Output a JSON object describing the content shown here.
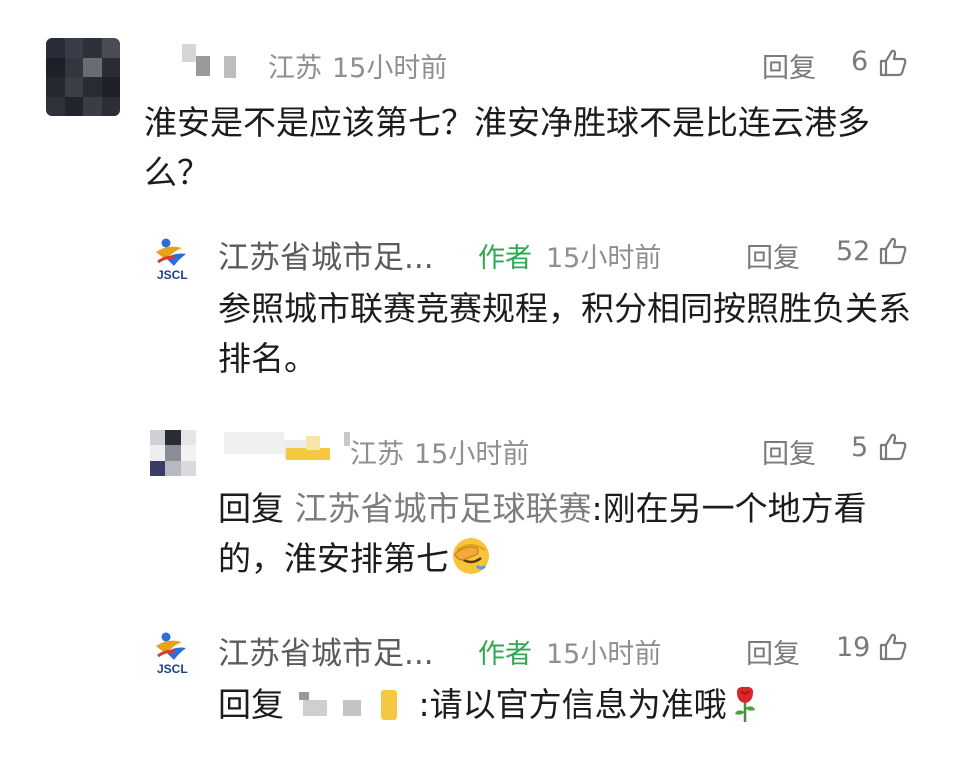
{
  "comments": [
    {
      "region": "江苏",
      "time": "15小时前",
      "text": "淮安是不是应该第七？淮安净胜球不是比连云港多么？",
      "reply_label": "回复",
      "likes": "6"
    },
    {
      "user_name": "江苏省城市足...",
      "author_badge": "作者",
      "time": "15小时前",
      "text": "参照城市联赛竞赛规程，积分相同按照胜负关系排名。",
      "reply_label": "回复",
      "likes": "52",
      "avatar_text": "JSCL"
    },
    {
      "region": "江苏",
      "time": "15小时前",
      "reply_prefix": "回复",
      "quoted_user": "江苏省城市足球联赛",
      "text": ":刚在另一个地方看的，淮安排第七",
      "reply_label": "回复",
      "likes": "5"
    },
    {
      "user_name": "江苏省城市足...",
      "author_badge": "作者",
      "time": "15小时前",
      "reply_prefix": "回复",
      "text": ":请以官方信息为准哦",
      "reply_label": "回复",
      "likes": "19",
      "avatar_text": "JSCL"
    }
  ],
  "colors": {
    "author": "#2fa84f",
    "meta": "#8f8f8f",
    "text": "#1c1c1c"
  },
  "icons": [
    "thumb-up-icon",
    "facepalm-emoji",
    "rose-emoji",
    "jscl-logo"
  ]
}
